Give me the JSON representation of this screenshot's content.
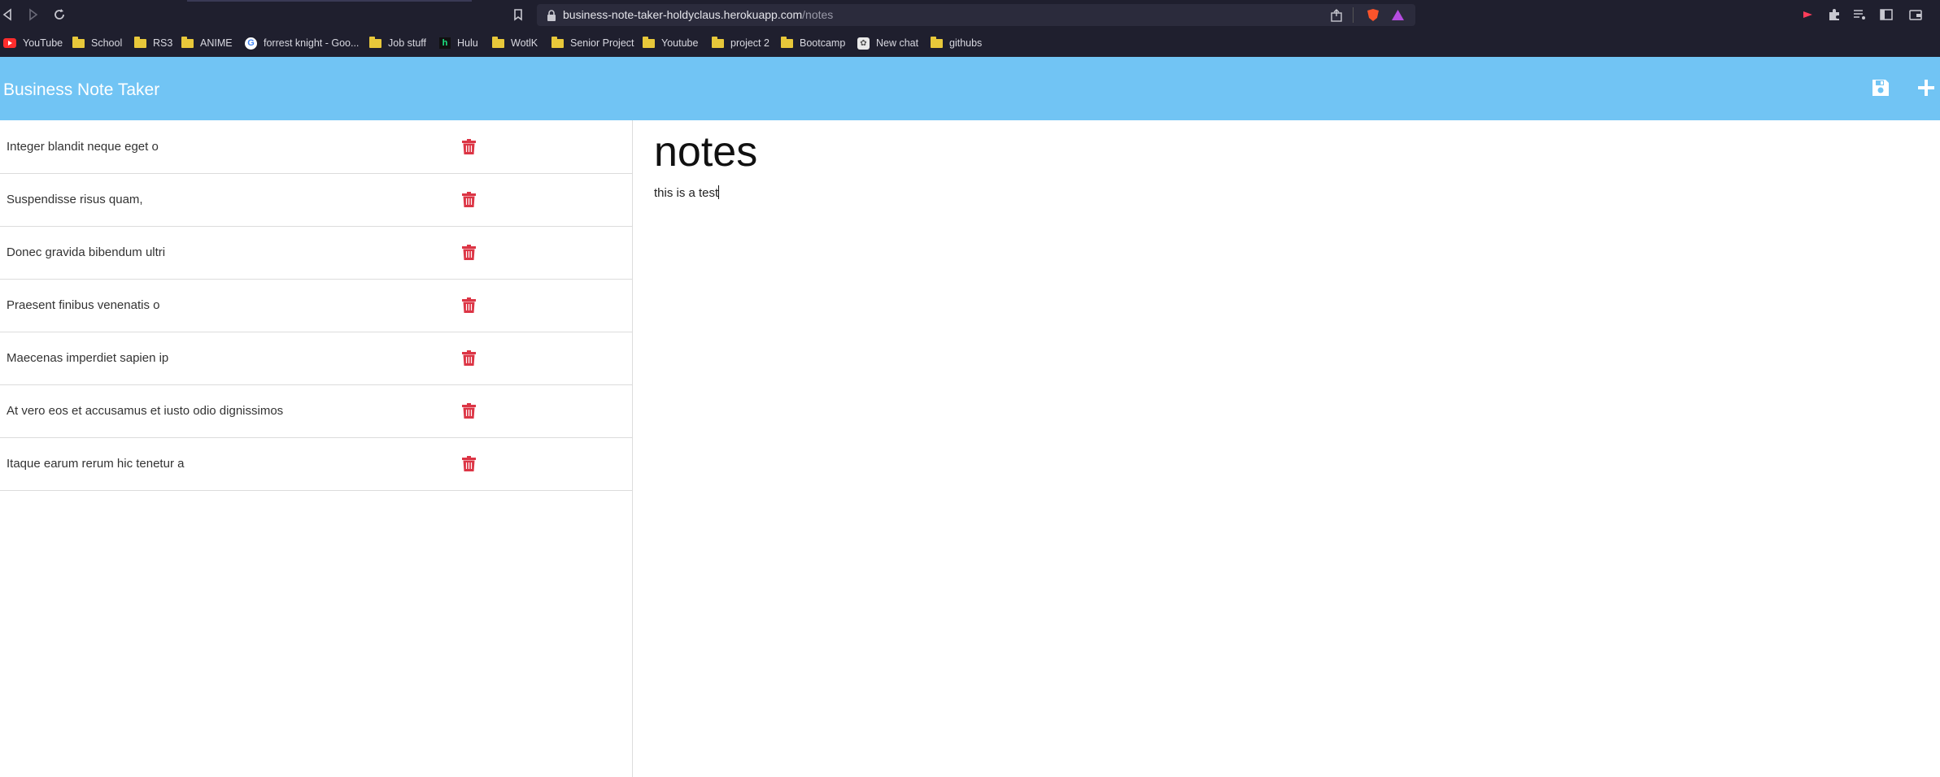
{
  "browser": {
    "url_host": "business-note-taker-holdyclaus.herokuapp.com",
    "url_path": "/notes",
    "bookmarks": [
      {
        "label": "YouTube",
        "icon": "youtube-icon"
      },
      {
        "label": "School",
        "icon": "folder-icon"
      },
      {
        "label": "RS3",
        "icon": "folder-icon"
      },
      {
        "label": "ANIME",
        "icon": "folder-icon"
      },
      {
        "label": "forrest knight - Goo...",
        "icon": "google-icon"
      },
      {
        "label": "Job stuff",
        "icon": "folder-icon"
      },
      {
        "label": "Hulu",
        "icon": "hulu-icon"
      },
      {
        "label": "WotlK",
        "icon": "folder-icon"
      },
      {
        "label": "Senior Project",
        "icon": "folder-icon"
      },
      {
        "label": "Youtube",
        "icon": "folder-icon"
      },
      {
        "label": "project 2",
        "icon": "folder-icon"
      },
      {
        "label": "Bootcamp",
        "icon": "folder-icon"
      },
      {
        "label": "New chat",
        "icon": "chatgpt-icon"
      },
      {
        "label": "githubs",
        "icon": "folder-icon"
      }
    ]
  },
  "app": {
    "title": "Business Note Taker",
    "header_icons": [
      "save-icon",
      "plus-icon"
    ],
    "accent_color": "#71c4f4",
    "delete_color": "#dc3545"
  },
  "notes": [
    {
      "title": "Integer blandit neque eget o"
    },
    {
      "title": "Suspendisse risus quam,"
    },
    {
      "title": "Donec gravida bibendum ultri"
    },
    {
      "title": "Praesent finibus venenatis o"
    },
    {
      "title": "Maecenas imperdiet sapien ip"
    },
    {
      "title": "At vero eos et accusamus et iusto odio dignissimos"
    },
    {
      "title": "Itaque earum rerum hic tenetur a"
    }
  ],
  "active_note": {
    "title": "notes",
    "text": "this is a test"
  }
}
